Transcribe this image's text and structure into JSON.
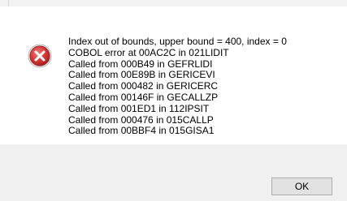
{
  "message": {
    "lines": [
      "Index out of bounds, upper bound = 400, index = 0",
      "COBOL error at 00AC2C in 021LIDIT",
      "Called from 000B49 in GEFRLIDI",
      "Called from 00E89B in GERICEVI",
      "Called from 000482 in GERICERC",
      "Called from 00146F in GECALLZP",
      "Called from 001ED1 in 112IPSIT",
      "Called from 000476 in 015CALLP",
      "Called from 00BBF4 in 015GISA1"
    ]
  },
  "icon": {
    "name": "error-icon",
    "color": "#c72c2c"
  },
  "buttons": {
    "ok_label": "OK"
  }
}
